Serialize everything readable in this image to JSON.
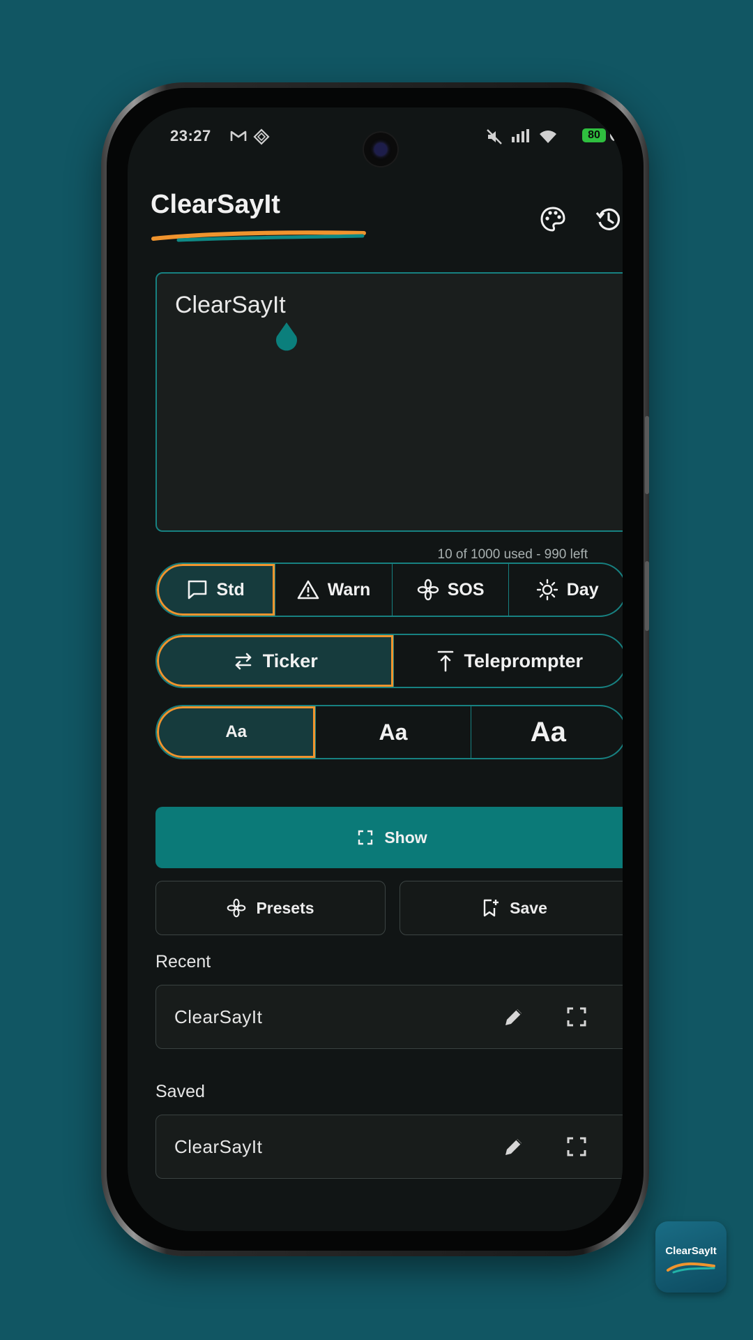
{
  "status_bar": {
    "time": "23:27",
    "battery": "80"
  },
  "app": {
    "title": "ClearSayIt"
  },
  "editor": {
    "text": "ClearSayIt",
    "counter": "10 of 1000 used - 990 left"
  },
  "modes": [
    {
      "label": "Std",
      "icon": "chat-bubble-icon",
      "selected": true
    },
    {
      "label": "Warn",
      "icon": "warning-triangle-icon",
      "selected": false
    },
    {
      "label": "SOS",
      "icon": "asterisk-flower-icon",
      "selected": false
    },
    {
      "label": "Day",
      "icon": "sun-icon",
      "selected": false
    }
  ],
  "display_types": [
    {
      "label": "Ticker",
      "icon": "swap-arrows-icon",
      "selected": true
    },
    {
      "label": "Teleprompter",
      "icon": "arrow-up-to-line-icon",
      "selected": false
    }
  ],
  "font_sizes": [
    {
      "label": "Aa",
      "selected": true
    },
    {
      "label": "Aa",
      "selected": false
    },
    {
      "label": "Aa",
      "selected": false
    }
  ],
  "actions": {
    "show": "Show",
    "presets": "Presets",
    "save": "Save"
  },
  "recent": {
    "heading": "Recent",
    "items": [
      "ClearSayIt"
    ]
  },
  "saved": {
    "heading": "Saved",
    "items": [
      "ClearSayIt"
    ]
  },
  "badge": {
    "text": "ClearSayIt"
  },
  "colors": {
    "accent": "#0b7a78",
    "selection": "#f0942e",
    "border": "#178181",
    "background": "#115663"
  }
}
